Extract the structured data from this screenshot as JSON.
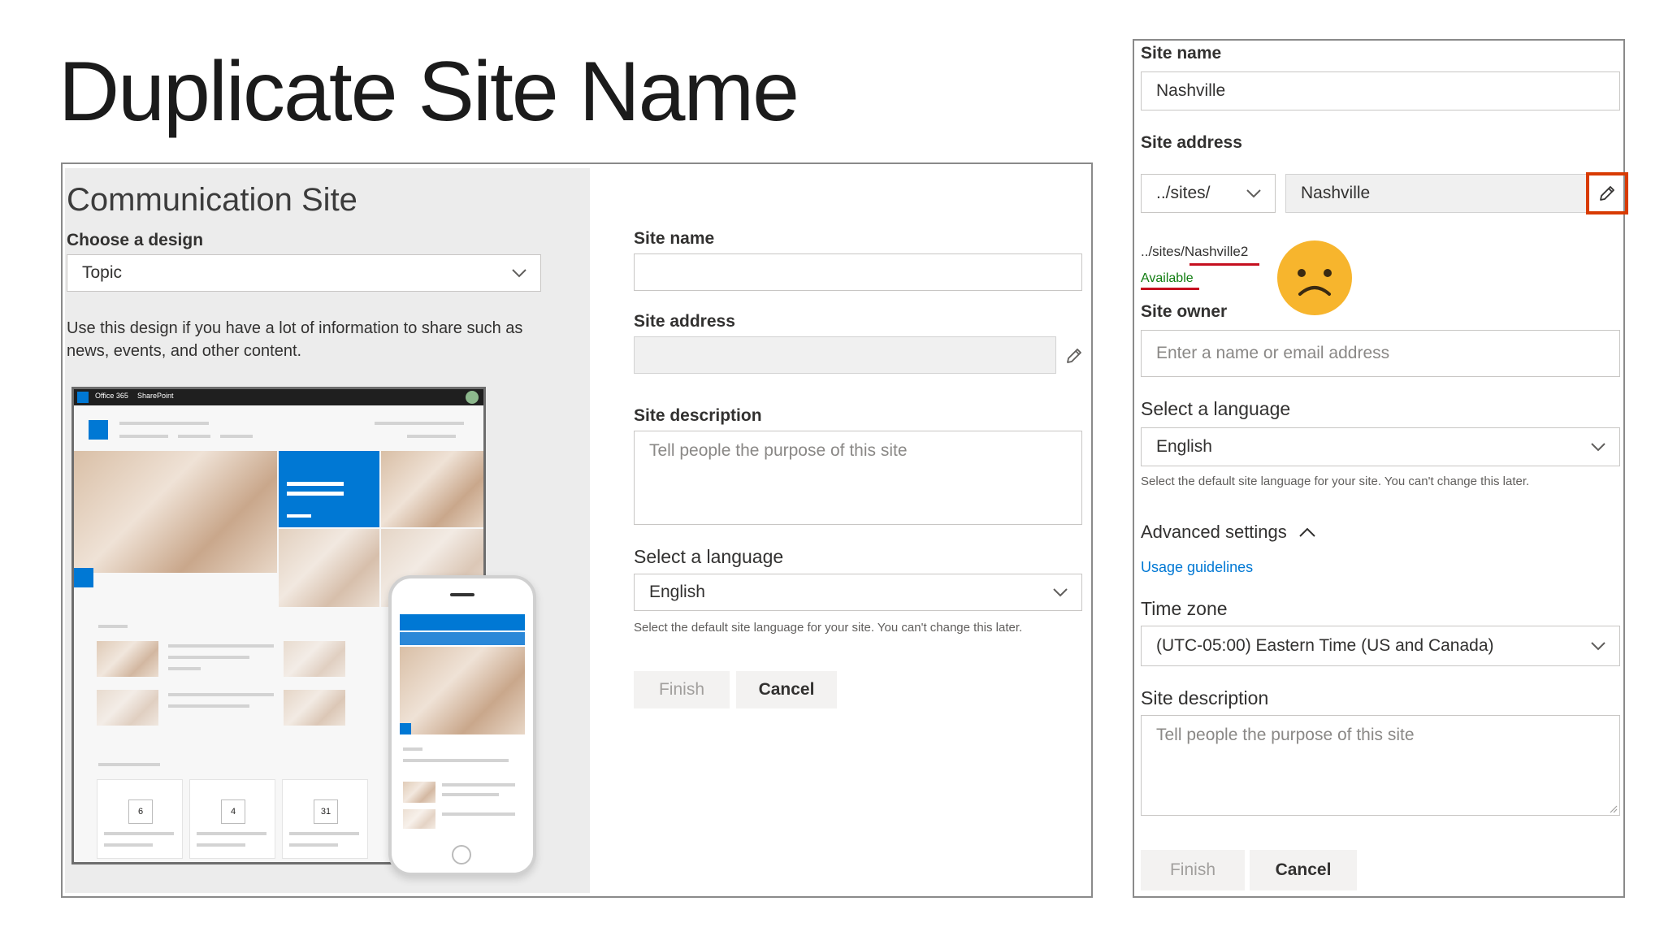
{
  "slide": {
    "title": "Duplicate Site Name"
  },
  "left_form": {
    "panel_title": "Communication Site",
    "design_label": "Choose a design",
    "design_value": "Topic",
    "design_description": "Use this design if you have a lot of information to share such as news, events, and other content.",
    "site_name_label": "Site name",
    "site_name_value": "",
    "site_address_label": "Site address",
    "site_address_value": "",
    "site_description_label": "Site description",
    "site_description_placeholder": "Tell people the purpose of this site",
    "language_label": "Select a language",
    "language_value": "English",
    "language_help": "Select the default site language for your site. You can't change this later.",
    "finish_label": "Finish",
    "cancel_label": "Cancel",
    "preview": {
      "brand_left": "Office 365",
      "brand_right": "SharePoint",
      "date_cards": [
        "6",
        "4",
        "31"
      ]
    }
  },
  "right_form": {
    "site_name_label": "Site name",
    "site_name_value": "Nashville",
    "site_address_label": "Site address",
    "address_prefix": "../sites/",
    "address_value": "Nashville",
    "suggested_path_prefix": "../sites/",
    "suggested_path_name": "Nashville2",
    "availability": "Available",
    "site_owner_label": "Site owner",
    "site_owner_placeholder": "Enter a name or email address",
    "language_label": "Select a language",
    "language_value": "English",
    "language_help": "Select the default site language for your site. You can't change this later.",
    "advanced_settings_label": "Advanced settings",
    "usage_guidelines_link": "Usage guidelines",
    "time_zone_label": "Time zone",
    "time_zone_value": "(UTC-05:00) Eastern Time (US and Canada)",
    "site_description_label": "Site description",
    "site_description_placeholder": "Tell people the purpose of this site",
    "finish_label": "Finish",
    "cancel_label": "Cancel"
  },
  "colors": {
    "highlight_red": "#d83b01",
    "underline_red": "#c50f1f",
    "available_green": "#107c10",
    "link_blue": "#0078d4",
    "sad_face_yellow": "#f7b52d",
    "sharepoint_blue": "#0078d4"
  },
  "icons": {
    "edit": "pencil-icon",
    "dropdown": "chevron-down-icon",
    "advanced": "chevron-up-icon",
    "emoji": "sad-face-icon"
  }
}
